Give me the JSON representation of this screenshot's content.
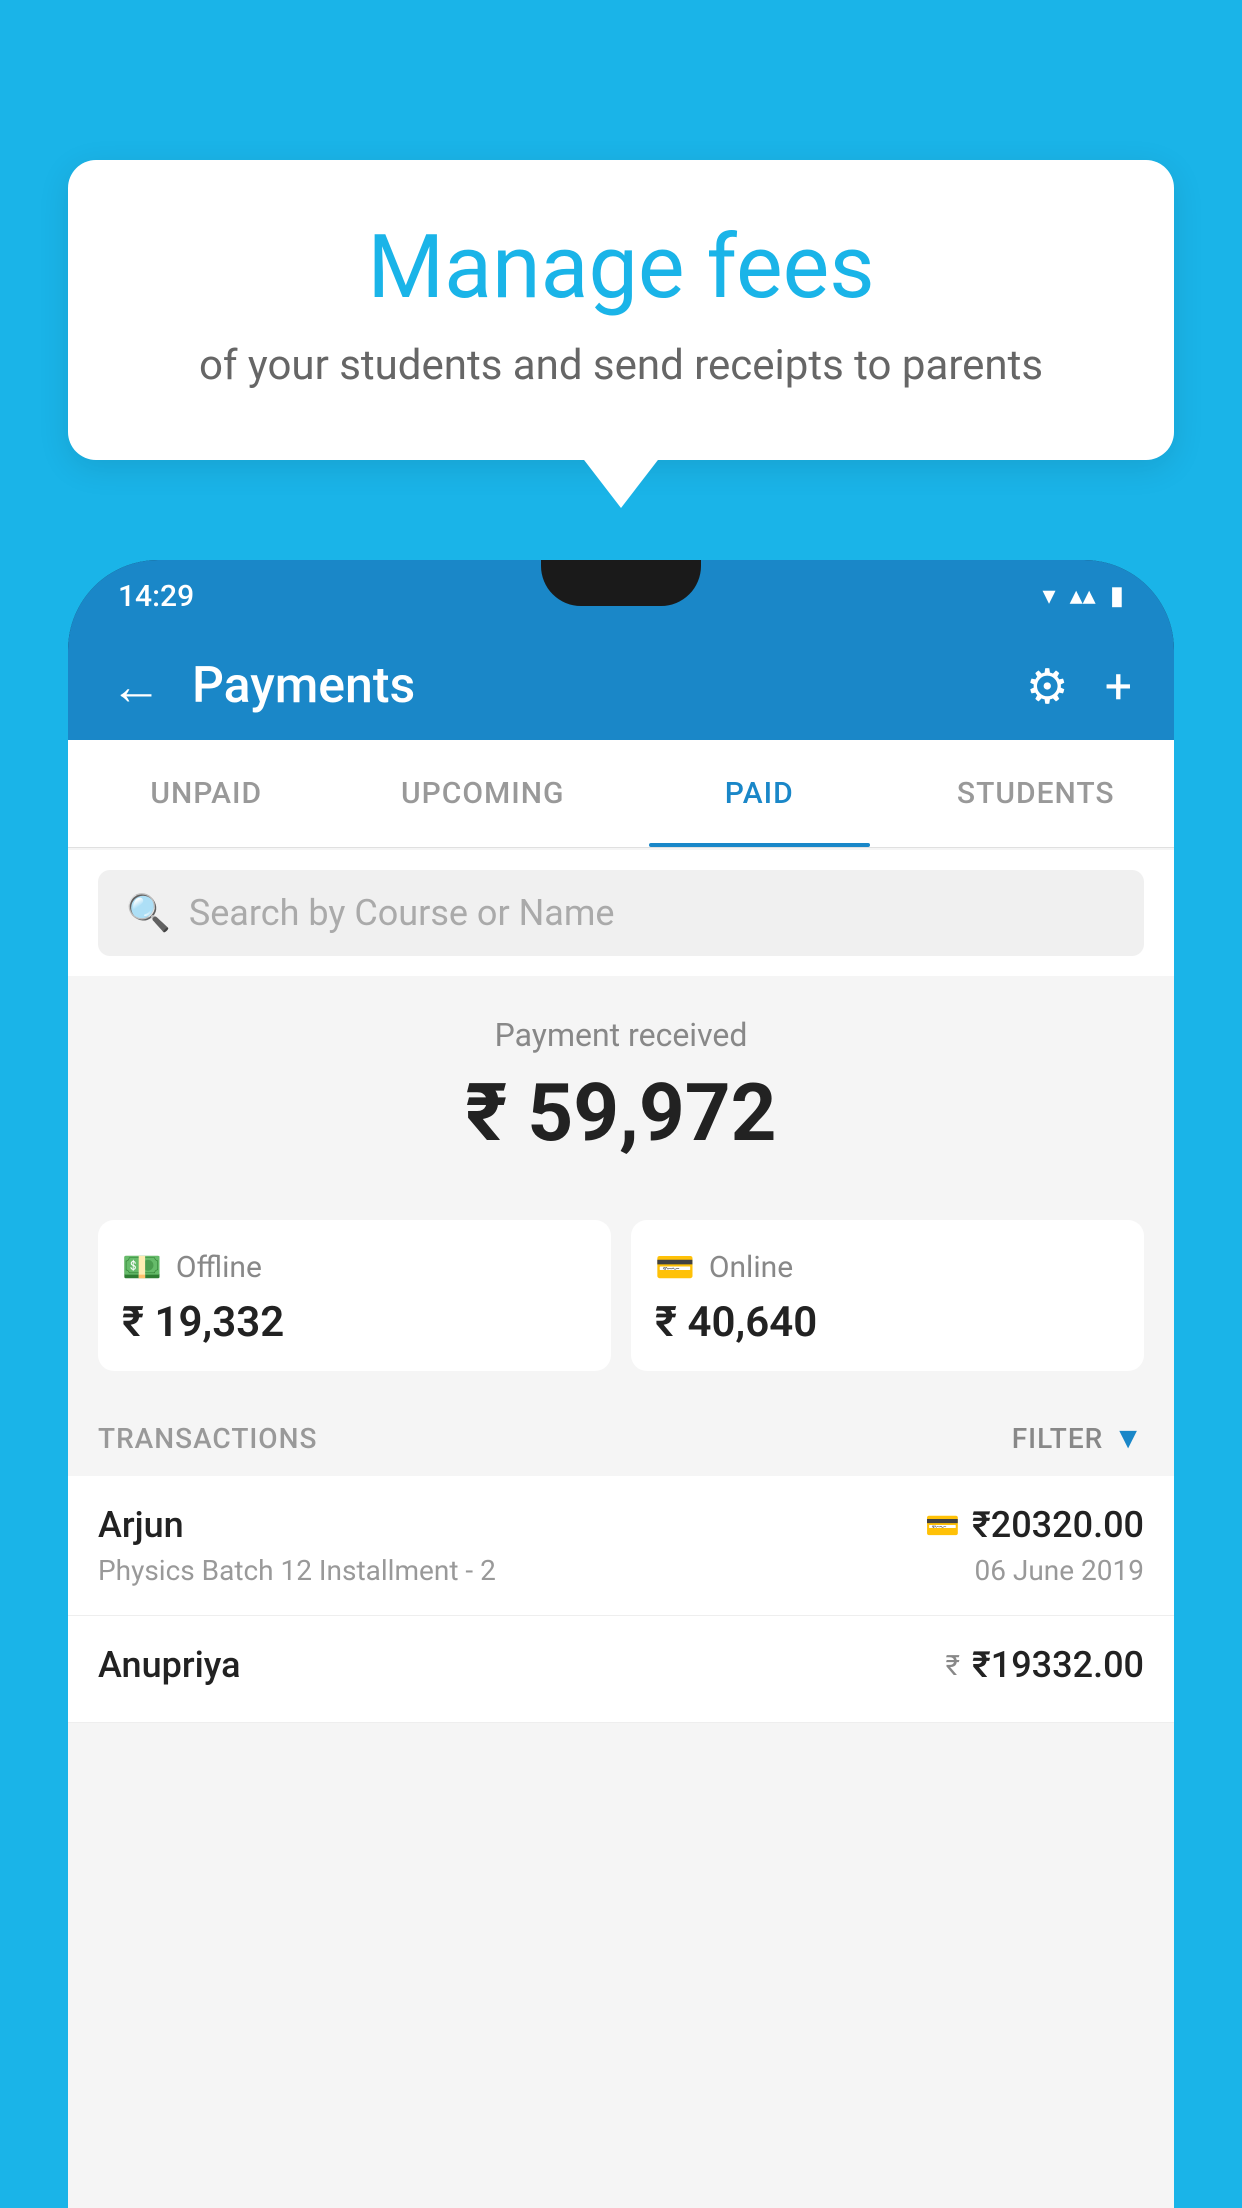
{
  "background_color": "#1ab4e8",
  "speech_bubble": {
    "title": "Manage fees",
    "subtitle": "of your students and send receipts to parents"
  },
  "status_bar": {
    "time": "14:29",
    "wifi_icon": "▼",
    "signal_icon": "▲",
    "battery_icon": "▮"
  },
  "header": {
    "back_label": "←",
    "title": "Payments",
    "settings_icon": "⚙",
    "add_icon": "+"
  },
  "tabs": [
    {
      "label": "UNPAID",
      "active": false
    },
    {
      "label": "UPCOMING",
      "active": false
    },
    {
      "label": "PAID",
      "active": true
    },
    {
      "label": "STUDENTS",
      "active": false
    }
  ],
  "search": {
    "placeholder": "Search by Course or Name"
  },
  "payment_summary": {
    "label": "Payment received",
    "amount": "₹ 59,972",
    "offline": {
      "label": "Offline",
      "amount": "₹ 19,332"
    },
    "online": {
      "label": "Online",
      "amount": "₹ 40,640"
    }
  },
  "transactions": {
    "section_label": "TRANSACTIONS",
    "filter_label": "FILTER",
    "rows": [
      {
        "name": "Arjun",
        "detail": "Physics Batch 12 Installment - 2",
        "amount": "₹20320.00",
        "date": "06 June 2019",
        "payment_type": "card"
      },
      {
        "name": "Anupriya",
        "detail": "",
        "amount": "₹19332.00",
        "date": "",
        "payment_type": "cash"
      }
    ]
  }
}
